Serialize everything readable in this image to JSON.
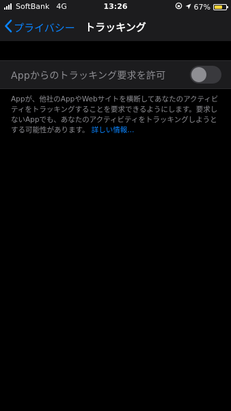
{
  "status_bar": {
    "carrier": "SoftBank",
    "network": "4G",
    "time": "13:26",
    "battery_percent": "67%",
    "battery_level": 0.67,
    "battery_fill_color": "#f5d33a",
    "icons": [
      "signal-icon",
      "lock-rotation-icon",
      "location-arrow-icon",
      "battery-icon"
    ]
  },
  "nav": {
    "back_label": "プライバシー",
    "title": "トラッキング"
  },
  "setting": {
    "label": "Appからのトラッキング要求を許可",
    "toggle_state": "off"
  },
  "footer": {
    "description": "Appが、他社のAppやWebサイトを横断してあなたのアクティビティをトラッキングすることを要求できるようにします。要求しないAppでも、あなたのアクティビティをトラッキングしようとする可能性があります。",
    "link": "詳しい情報..."
  },
  "colors": {
    "background": "#000000",
    "grouped_cell": "#1c1c1e",
    "accent": "#0a84ff",
    "secondary_text": "#8e8e93"
  }
}
